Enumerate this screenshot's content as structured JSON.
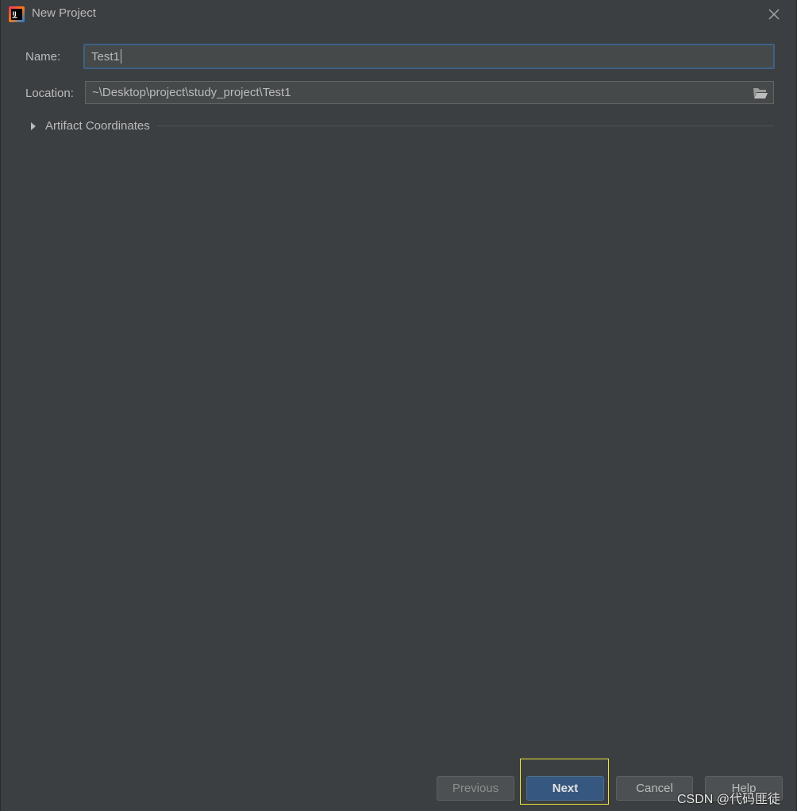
{
  "window": {
    "title": "New Project",
    "app_icon": "intellij-idea-icon",
    "close_icon": "close-icon"
  },
  "form": {
    "name_label": "Name:",
    "name_value": "Test1",
    "location_label": "Location:",
    "location_value": "~\\Desktop\\project\\study_project\\Test1",
    "folder_icon": "folder-open-icon"
  },
  "sections": {
    "artifact_label": "Artifact Coordinates",
    "artifact_expanded": false,
    "artifact_icon": "chevron-right-icon"
  },
  "buttons": {
    "previous": "Previous",
    "next": "Next",
    "cancel": "Cancel",
    "help": "Help"
  },
  "watermark": "CSDN @代码匪徒",
  "colors": {
    "background": "#3c3f41",
    "primary_button": "#365880",
    "highlight": "#e8e53a",
    "focus_border": "#3d6185"
  }
}
